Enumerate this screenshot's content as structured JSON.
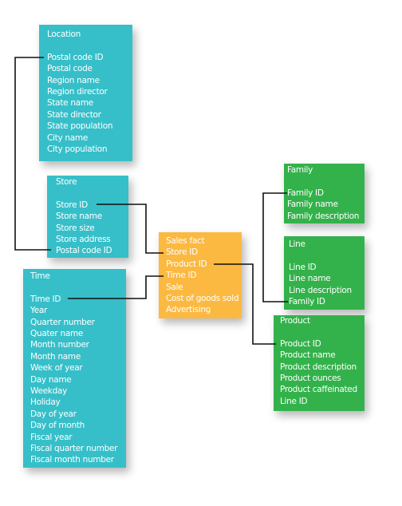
{
  "colors": {
    "dimension_teal": "#36bfc9",
    "fact_orange": "#fbb942",
    "dimension_green": "#33b24b",
    "connector": "#111111"
  },
  "tables": {
    "location": {
      "title": "Location",
      "fields": [
        "Postal code ID",
        "Postal code",
        "Region name",
        "Region director",
        "State name",
        "State director",
        "State population",
        "City name",
        "City population"
      ]
    },
    "store": {
      "title": "Store",
      "fields": [
        "Store ID",
        "Store name",
        "Store size",
        "Store address",
        "Postal code ID"
      ]
    },
    "time": {
      "title": "Time",
      "fields": [
        "Time ID",
        "Year",
        "Quarter number",
        "Quater name",
        "Month number",
        "Month name",
        "Week of year",
        "Day name",
        "Weekday",
        "Holiday",
        "Day of year",
        "Day of month",
        "Fiscal year",
        "Fiscal quarter number",
        "Fiscal month number"
      ]
    },
    "sales_fact": {
      "title": "Sales fact",
      "fields": [
        "Store ID",
        "Product ID",
        "Time ID",
        "Sale",
        "Cost of goods sold",
        "Advertising"
      ]
    },
    "family": {
      "title": "Family",
      "fields": [
        "Family ID",
        "Family name",
        "Family description"
      ]
    },
    "line": {
      "title": "Line",
      "fields": [
        "Line ID",
        "Line name",
        "Line description",
        "Family ID"
      ]
    },
    "product": {
      "title": "Product",
      "fields": [
        "Product ID",
        "Product name",
        "Product description",
        "Product ounces",
        "Product caffeinated",
        "Line ID"
      ]
    }
  }
}
